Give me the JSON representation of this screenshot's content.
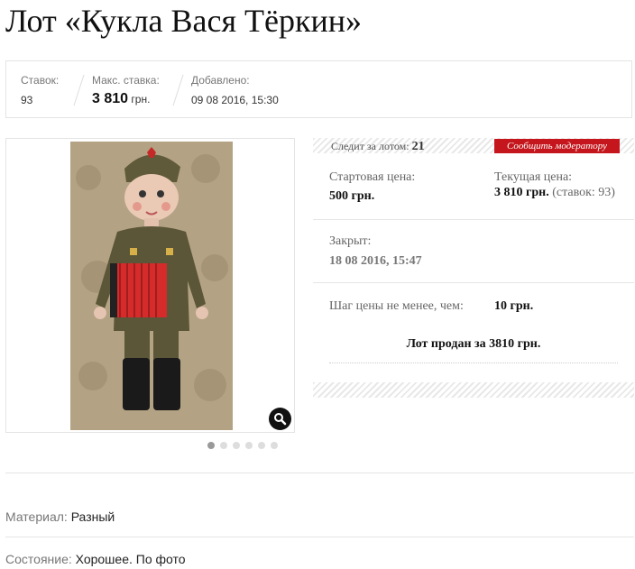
{
  "lot": {
    "title": "Лот «Кукла Вася Тёркин»"
  },
  "stats": {
    "bids_label": "Ставок:",
    "bids_value": "93",
    "max_bid_label": "Макс. ставка:",
    "max_bid_value": "3 810",
    "max_bid_currency": "грн.",
    "added_label": "Добавлено:",
    "added_value": "09 08 2016, 15:30"
  },
  "gallery": {
    "image_count": 6,
    "active_index": 0
  },
  "side": {
    "followers_label": "Следит за лотом:",
    "followers_value": "21",
    "report_button": "Сообщить модератору",
    "start_price_label": "Стартовая цена:",
    "start_price_value": "500 грн.",
    "current_price_label": "Текущая цена:",
    "current_price_value": "3 810 грн.",
    "current_price_bids": "(ставок: 93)",
    "closed_label": "Закрыт:",
    "closed_value": "18 08 2016, 15:47",
    "step_label": "Шаг цены не менее, чем:",
    "step_value": "10 грн.",
    "sold_text": "Лот продан за 3810 грн."
  },
  "properties": {
    "material_label": "Материал:",
    "material_value": "Разный",
    "condition_label": "Состояние:",
    "condition_value": "Хорошее. По фото"
  },
  "colors": {
    "accent": "#c4161c"
  }
}
